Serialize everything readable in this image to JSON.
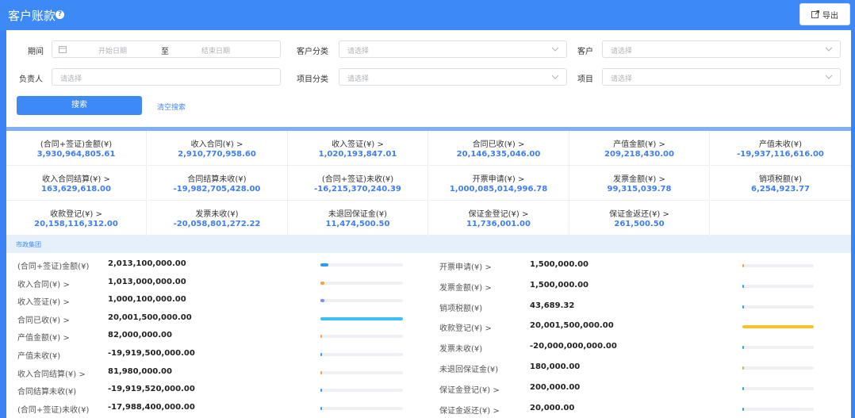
{
  "header": {
    "title": "客户账款",
    "help_icon": "question-icon",
    "export_label": "导出"
  },
  "filters": {
    "period_label": "期间",
    "start_placeholder": "开始日期",
    "to_label": "至",
    "end_placeholder": "结束日期",
    "customer_category_label": "客户分类",
    "customer_category_placeholder": "请选择",
    "customer_label": "客户",
    "customer_placeholder": "请选择",
    "owner_label": "负责人",
    "owner_placeholder": "请选择",
    "project_category_label": "项目分类",
    "project_category_placeholder": "请选择",
    "project_label": "项目",
    "project_placeholder": "请选择",
    "search_label": "搜索",
    "clear_label": "清空搜索"
  },
  "stats": [
    {
      "label": "(合同+签证)金额(¥)",
      "value": "3,930,964,805.61"
    },
    {
      "label": "收入合同(¥) >",
      "value": "2,910,770,958.60"
    },
    {
      "label": "收入签证(¥) >",
      "value": "1,020,193,847.01"
    },
    {
      "label": "合同已收(¥) >",
      "value": "20,146,335,046.00"
    },
    {
      "label": "产值金额(¥) >",
      "value": "209,218,430.00"
    },
    {
      "label": "产值未收(¥)",
      "value": "-19,937,116,616.00"
    },
    {
      "label": "收入合同结算(¥) >",
      "value": "163,629,618.00"
    },
    {
      "label": "合同结算未收(¥)",
      "value": "-19,982,705,428.00"
    },
    {
      "label": "(合同+签证)未收(¥)",
      "value": "-16,215,370,240.39"
    },
    {
      "label": "开票申请(¥) >",
      "value": "1,000,085,014,996.78"
    },
    {
      "label": "发票金额(¥) >",
      "value": "99,315,039.78"
    },
    {
      "label": "销项税额(¥)",
      "value": "6,254,923.77"
    },
    {
      "label": "收款登记(¥) >",
      "value": "20,158,116,312.00"
    },
    {
      "label": "发票未收(¥)",
      "value": "-20,058,801,272.22"
    },
    {
      "label": "未退回保证金(¥)",
      "value": "11,474,500.50"
    },
    {
      "label": "保证金登记(¥) >",
      "value": "11,736,001.00"
    },
    {
      "label": "保证金返还(¥) >",
      "value": "261,500.50"
    },
    {
      "label": "",
      "value": ""
    }
  ],
  "group": {
    "name": "市政集团",
    "left_rows": [
      {
        "label": "(合同+签证)金额(¥)",
        "value": "2,013,100,000.00",
        "bar_fraction": 0.1,
        "bar_color": "#2f9cf2"
      },
      {
        "label": "收入合同(¥) >",
        "value": "1,013,000,000.00",
        "bar_fraction": 0.05,
        "bar_color": "#f5a04a"
      },
      {
        "label": "收入签证(¥) >",
        "value": "1,000,100,000.00",
        "bar_fraction": 0.05,
        "bar_color": "#7b8ef0"
      },
      {
        "label": "合同已收(¥) >",
        "value": "20,001,500,000.00",
        "bar_fraction": 1.0,
        "bar_color": "#3fc0f5"
      },
      {
        "label": "产值金额(¥) >",
        "value": "82,000,000.00",
        "bar_fraction": 0.02,
        "bar_color": "#f5a04a"
      },
      {
        "label": "产值未收(¥)",
        "value": "-19,919,500,000.00",
        "bar_fraction": 0.0,
        "bar_color": "#2f9cf2"
      },
      {
        "label": "收入合同结算(¥) >",
        "value": "81,980,000.00",
        "bar_fraction": 0.02,
        "bar_color": "#f5a04a"
      },
      {
        "label": "合同结算未收(¥)",
        "value": "-19,919,520,000.00",
        "bar_fraction": 0.0,
        "bar_color": "#2f9cf2"
      },
      {
        "label": "(合同+签证)未收(¥)",
        "value": "-17,988,400,000.00",
        "bar_fraction": 0.02,
        "bar_color": "#2f9cf2"
      }
    ],
    "right_rows": [
      {
        "label": "开票申请(¥) >",
        "value": "1,500,000.00",
        "bar_fraction": 0.02,
        "bar_color": "#f5a04a"
      },
      {
        "label": "发票金额(¥) >",
        "value": "1,500,000.00",
        "bar_fraction": 0.02,
        "bar_color": "#2f9cf2"
      },
      {
        "label": "销项税额(¥)",
        "value": "43,689.32",
        "bar_fraction": 0.02,
        "bar_color": "#2f9cf2"
      },
      {
        "label": "收款登记(¥) >",
        "value": "20,001,500,000.00",
        "bar_fraction": 1.0,
        "bar_color": "#f5c22a"
      },
      {
        "label": "发票未收(¥)",
        "value": "-20,000,000,000.00",
        "bar_fraction": 0.02,
        "bar_color": "#2f9cf2"
      },
      {
        "label": "未退回保证金(¥)",
        "value": "180,000.00",
        "bar_fraction": 0.02,
        "bar_color": "#f5a04a"
      },
      {
        "label": "保证金登记(¥) >",
        "value": "200,000.00",
        "bar_fraction": 0.02,
        "bar_color": "#2f9cf2"
      },
      {
        "label": "保证金返还(¥) >",
        "value": "20,000.00",
        "bar_fraction": 0.02,
        "bar_color": "#2f9cf2"
      }
    ]
  }
}
